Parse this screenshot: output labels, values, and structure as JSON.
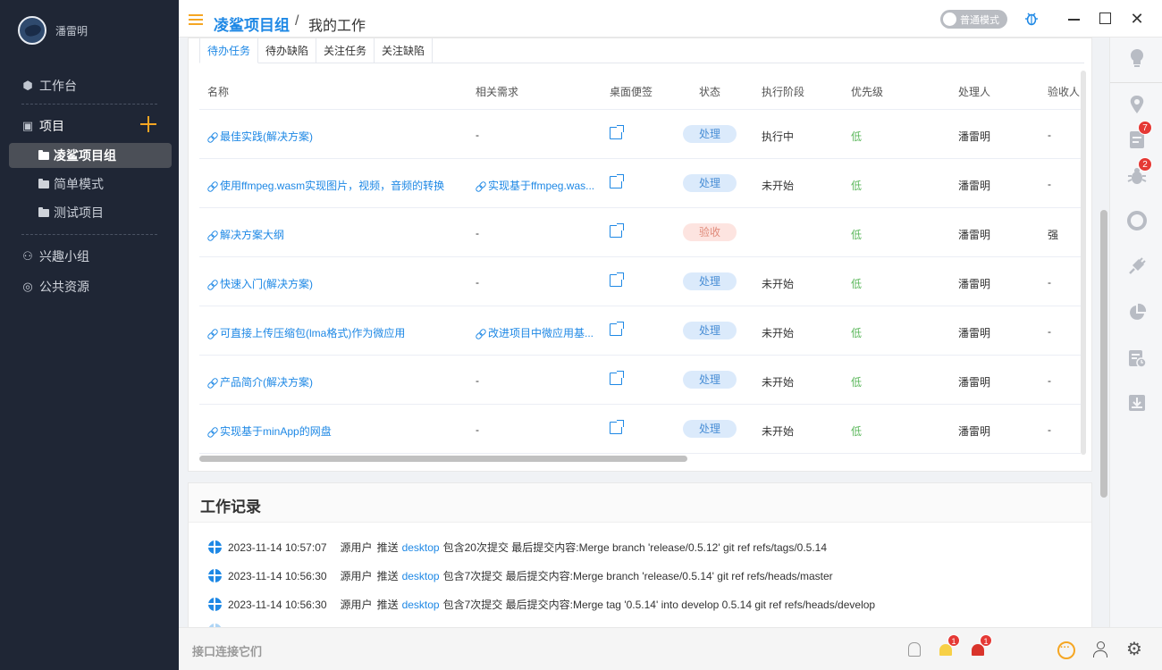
{
  "sidebar": {
    "user_name": "潘雷明",
    "workbench": "工作台",
    "projects": "项目",
    "sub_items": [
      "凌鲨项目组",
      "简单模式",
      "测试项目"
    ],
    "interest_group": "兴趣小组",
    "public_resources": "公共资源"
  },
  "header": {
    "project": "凌鲨项目组",
    "separator": "/",
    "page": "我的工作",
    "mode": "普通模式"
  },
  "tabs": [
    "待办任务",
    "待办缺陷",
    "关注任务",
    "关注缺陷"
  ],
  "table": {
    "columns": [
      "名称",
      "相关需求",
      "桌面便签",
      "状态",
      "执行阶段",
      "优先级",
      "处理人",
      "验收人"
    ],
    "rows": [
      {
        "name": "最佳实践(解决方案)",
        "req": "-",
        "status": "处理",
        "stage": "执行中",
        "priority": "低",
        "handler": "潘雷明",
        "acceptor": "-"
      },
      {
        "name": "使用ffmpeg.wasm实现图片，视频，音频的转换",
        "req": "实现基于ffmpeg.was...",
        "status": "处理",
        "stage": "未开始",
        "priority": "低",
        "handler": "潘雷明",
        "acceptor": "-"
      },
      {
        "name": "解决方案大纲",
        "req": "-",
        "status": "验收",
        "stage": "",
        "priority": "低",
        "handler": "潘雷明",
        "acceptor": "强"
      },
      {
        "name": "快速入门(解决方案)",
        "req": "-",
        "status": "处理",
        "stage": "未开始",
        "priority": "低",
        "handler": "潘雷明",
        "acceptor": "-"
      },
      {
        "name": "可直接上传压缩包(lma格式)作为微应用",
        "req": "改进项目中微应用基...",
        "status": "处理",
        "stage": "未开始",
        "priority": "低",
        "handler": "潘雷明",
        "acceptor": "-"
      },
      {
        "name": "产品简介(解决方案)",
        "req": "-",
        "status": "处理",
        "stage": "未开始",
        "priority": "低",
        "handler": "潘雷明",
        "acceptor": "-"
      },
      {
        "name": "实现基于minApp的网盘",
        "req": "-",
        "status": "处理",
        "stage": "未开始",
        "priority": "低",
        "handler": "潘雷明",
        "acceptor": "-"
      }
    ]
  },
  "work_log": {
    "title": "工作记录",
    "entries": [
      {
        "time": "2023-11-14 10:57:07",
        "user": "源用户",
        "action": "推送",
        "repo": "desktop",
        "detail": "包含20次提交 最后提交内容:Merge branch 'release/0.5.12' git ref refs/tags/0.5.14"
      },
      {
        "time": "2023-11-14 10:56:30",
        "user": "源用户",
        "action": "推送",
        "repo": "desktop",
        "detail": "包含7次提交 最后提交内容:Merge branch 'release/0.5.14' git ref refs/heads/master"
      },
      {
        "time": "2023-11-14 10:56:30",
        "user": "源用户",
        "action": "推送",
        "repo": "desktop",
        "detail": "包含7次提交 最后提交内容:Merge tag '0.5.14' into develop 0.5.14 git ref refs/heads/develop"
      }
    ]
  },
  "footer": {
    "status": "接口连接它们",
    "alert_yellow_count": "1",
    "alert_red_count": "1"
  },
  "rail": {
    "doc_badge": "7",
    "bug_badge": "2"
  }
}
